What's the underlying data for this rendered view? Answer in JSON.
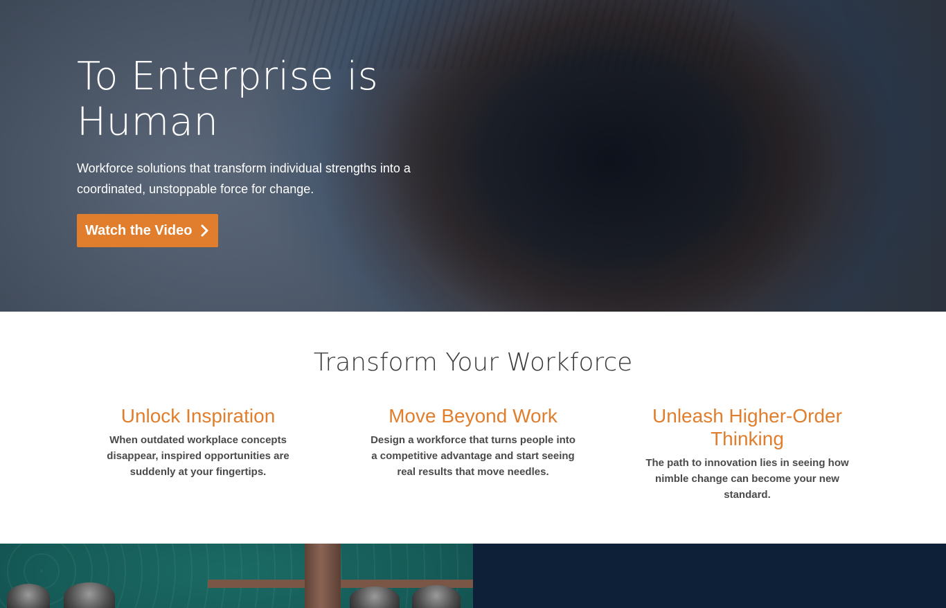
{
  "hero": {
    "title_line1": "To Enterprise is",
    "title_line2": "Human",
    "subtitle": "Workforce solutions that transform individual strengths into a coordinated, unstoppable force for change.",
    "cta_label": "Watch the Video",
    "cta_icon": "chevron-right-icon",
    "cta_color": "#e07e2d"
  },
  "transform": {
    "title": "Transform Your Workforce",
    "columns": [
      {
        "heading": "Unlock Inspiration",
        "text": "When outdated workplace concepts disappear, inspired opportunities are suddenly at your fingertips."
      },
      {
        "heading": "Move Beyond Work",
        "text": "Design a workforce that turns people into a competitive advantage and start seeing real results that move needles."
      },
      {
        "heading": "Unleash Higher-Order Thinking",
        "text": "The path to innovation lies in seeing how nimble change can become your new standard."
      }
    ],
    "accent_color": "#e07e2d"
  },
  "bottom": {
    "left_color": "#155a56",
    "right_color": "#0e1f38"
  }
}
